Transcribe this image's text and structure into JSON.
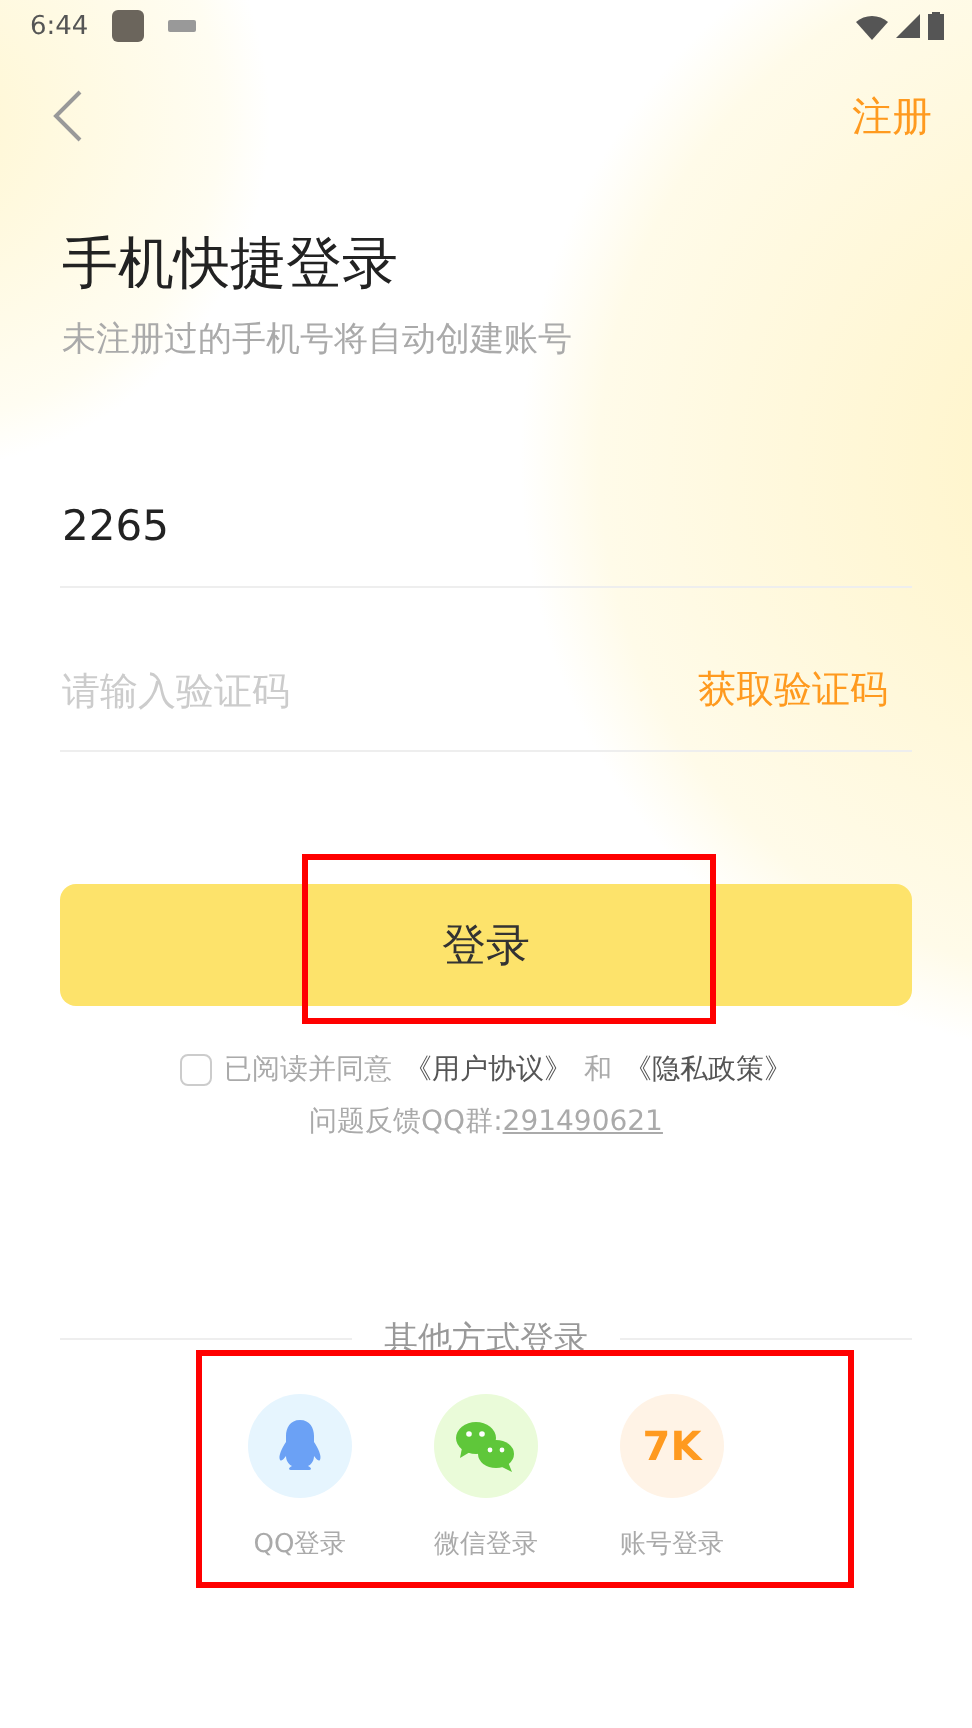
{
  "status_bar": {
    "time": "6:44"
  },
  "header": {
    "register_link": "注册"
  },
  "title": "手机快捷登录",
  "subtitle": "未注册过的手机号将自动创建账号",
  "phone_field": {
    "value": "2265"
  },
  "code_field": {
    "placeholder": "请输入验证码",
    "action": "获取验证码"
  },
  "login_button": "登录",
  "agreement": {
    "checked": false,
    "prefix": "已阅读并同意",
    "terms_link": "《用户协议》",
    "middle": "和",
    "privacy_link": "《隐私政策》"
  },
  "feedback": {
    "label": "问题反馈QQ群:",
    "group_number": "291490621"
  },
  "other_login": {
    "heading": "其他方式登录",
    "options": [
      {
        "kind": "qq",
        "label": "QQ登录"
      },
      {
        "kind": "wechat",
        "label": "微信登录"
      },
      {
        "kind": "account",
        "icon_text": "7K",
        "label": "账号登录"
      }
    ]
  }
}
